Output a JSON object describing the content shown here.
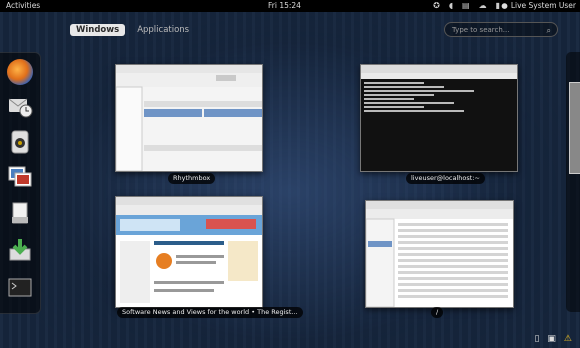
{
  "topbar": {
    "activities": "Activities",
    "clock": "Fri 15:24",
    "user": "Live System User",
    "icons": [
      "accessibility-icon",
      "volume-icon",
      "network-icon",
      "user-icon",
      "battery-icon"
    ]
  },
  "tabs": {
    "windows": "Windows",
    "applications": "Applications"
  },
  "search": {
    "placeholder": "Type to search..."
  },
  "dash": {
    "items": [
      "firefox-icon",
      "mail-icon",
      "rhythmbox-icon",
      "shotwell-icon",
      "documents-icon",
      "software-icon",
      "terminal-icon"
    ]
  },
  "windows": [
    {
      "caption": "Rhythmbox"
    },
    {
      "caption": "liveuser@localhost:~"
    },
    {
      "caption": "Software News and Views for the world • The Regist..."
    },
    {
      "caption": "/"
    }
  ],
  "tray": {
    "icons": [
      "removable-drive-icon",
      "printer-icon",
      "warning-icon"
    ]
  },
  "colors": {
    "topbar": "#000000",
    "background": "#16263d",
    "tab_active": "#e8e8e8"
  }
}
